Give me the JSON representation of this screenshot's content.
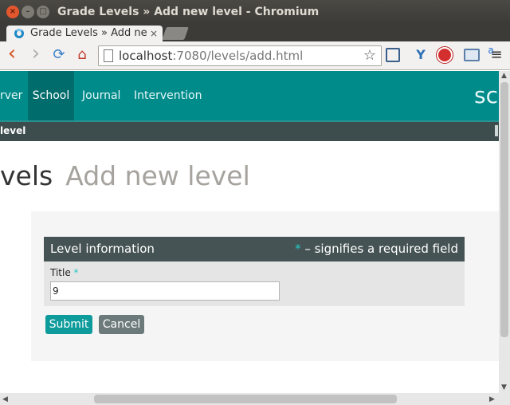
{
  "window": {
    "title": "Grade Levels » Add new level - Chromium",
    "close_glyph": "×",
    "min_glyph": "–",
    "max_glyph": "□"
  },
  "tab": {
    "label": "Grade Levels » Add ne",
    "close_glyph": "×"
  },
  "toolbar": {
    "url_host": "localhost",
    "url_rest": ":7080/levels/add.html",
    "back_glyph": "‹",
    "forward_glyph": "›",
    "reload_glyph": "⟳",
    "home_glyph": "⌂",
    "star_glyph": "☆",
    "menu_glyph": "≡"
  },
  "nav": {
    "items": [
      {
        "label": "rver"
      },
      {
        "label": "School"
      },
      {
        "label": "Journal"
      },
      {
        "label": "Intervention"
      }
    ],
    "brand_partial": "sc"
  },
  "subnav": {
    "label": "level"
  },
  "heading": {
    "main": "vels",
    "sub": "Add new level"
  },
  "form": {
    "section_title": "Level information",
    "required_star": "*",
    "required_note": " – signifies a required field",
    "title_label": "Title",
    "title_value": "9"
  },
  "buttons": {
    "submit": "Submit",
    "cancel": "Cancel"
  },
  "colors": {
    "nav_bg": "#008b8b",
    "nav_active": "#006c6c",
    "section_header": "#465354",
    "submit": "#0e9b9b",
    "cancel": "#6c7a7b",
    "required_star": "#26c6c6"
  }
}
